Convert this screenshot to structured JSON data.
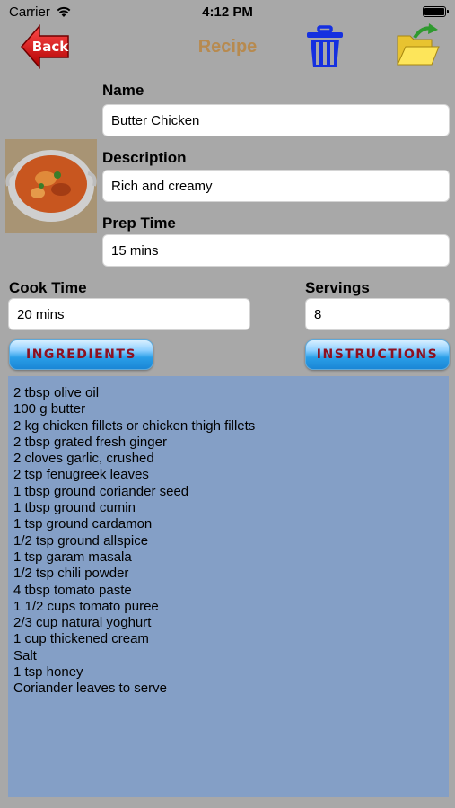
{
  "status_bar": {
    "carrier": "Carrier",
    "time": "4:12 PM"
  },
  "header": {
    "title": "Recipe",
    "back_label": "Back"
  },
  "form": {
    "name_label": "Name",
    "name_value": "Butter Chicken",
    "description_label": "Description",
    "description_value": "Rich and creamy",
    "prep_time_label": "Prep Time",
    "prep_time_value": "15 mins",
    "cook_time_label": "Cook Time",
    "cook_time_value": "20 mins",
    "servings_label": "Servings",
    "servings_value": "8"
  },
  "tabs": {
    "ingredients": "INGREDIENTS",
    "instructions": "INSTRUCTIONS"
  },
  "ingredients": [
    "2 tbsp olive oil",
    "100 g butter",
    "2 kg chicken fillets or chicken thigh fillets",
    "2 tbsp grated fresh ginger",
    "2 cloves garlic, crushed",
    "2 tsp fenugreek leaves",
    "1 tbsp ground coriander seed",
    "1 tbsp ground cumin",
    "1 tsp ground cardamon",
    "1/2 tsp ground allspice",
    "1 tsp garam masala",
    "1/2 tsp chili powder",
    "4 tbsp tomato paste",
    "1 1/2 cups tomato puree",
    "2/3 cup natural yoghurt",
    "1 cup thickened cream",
    "Salt",
    "1 tsp honey",
    "Coriander leaves to serve"
  ],
  "colors": {
    "background": "#a8a8a8",
    "title": "#b78a4f",
    "content_box": "#849fc6",
    "tab_text": "#8d1020",
    "trash": "#1530e0"
  },
  "icons": {
    "back": "back-arrow-icon",
    "trash": "trash-icon",
    "folder": "folder-open-icon",
    "wifi": "wifi-icon",
    "battery": "battery-icon"
  }
}
